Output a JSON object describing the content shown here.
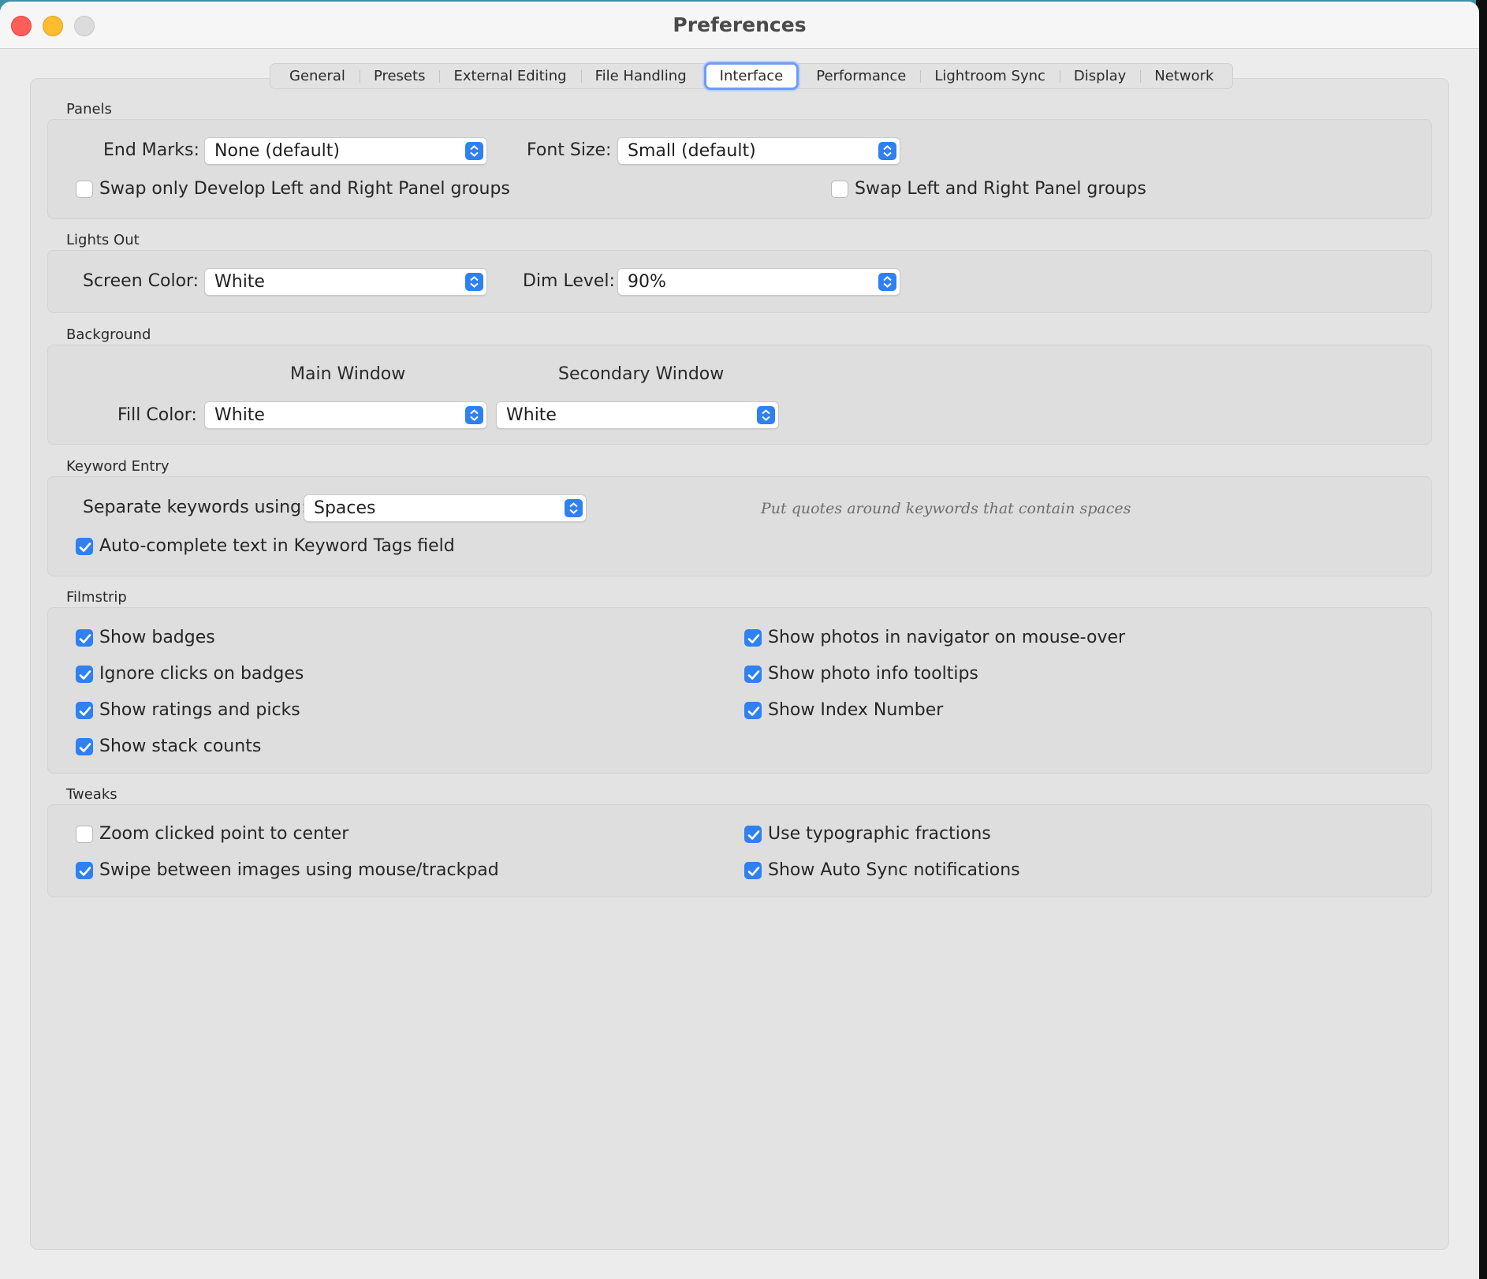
{
  "window": {
    "title": "Preferences"
  },
  "tabs": [
    {
      "label": "General",
      "selected": false
    },
    {
      "label": "Presets",
      "selected": false
    },
    {
      "label": "External Editing",
      "selected": false
    },
    {
      "label": "File Handling",
      "selected": false
    },
    {
      "label": "Interface",
      "selected": true
    },
    {
      "label": "Performance",
      "selected": false
    },
    {
      "label": "Lightroom Sync",
      "selected": false
    },
    {
      "label": "Display",
      "selected": false
    },
    {
      "label": "Network",
      "selected": false
    }
  ],
  "panels": {
    "title": "Panels",
    "end_marks": {
      "label": "End Marks:",
      "value": "None (default)"
    },
    "font_size": {
      "label": "Font Size:",
      "value": "Small (default)"
    },
    "swap_develop": {
      "label": "Swap only Develop Left and Right Panel groups",
      "checked": false
    },
    "swap_all": {
      "label": "Swap Left and Right Panel groups",
      "checked": false
    }
  },
  "lights_out": {
    "title": "Lights Out",
    "screen_color": {
      "label": "Screen Color:",
      "value": "White"
    },
    "dim_level": {
      "label": "Dim Level:",
      "value": "90%"
    }
  },
  "background": {
    "title": "Background",
    "main_window_header": "Main Window",
    "secondary_window_header": "Secondary Window",
    "fill_color_label": "Fill Color:",
    "main_value": "White",
    "secondary_value": "White"
  },
  "keyword_entry": {
    "title": "Keyword Entry",
    "separate": {
      "label": "Separate keywords using:",
      "value": "Spaces"
    },
    "hint": "Put quotes around keywords that contain spaces",
    "autocomplete": {
      "label": "Auto-complete text in Keyword Tags field",
      "checked": true
    }
  },
  "filmstrip": {
    "title": "Filmstrip",
    "show_badges": {
      "label": "Show badges",
      "checked": true
    },
    "ignore_clicks": {
      "label": "Ignore clicks on badges",
      "checked": true
    },
    "show_ratings": {
      "label": "Show ratings and picks",
      "checked": true
    },
    "show_stack": {
      "label": "Show stack counts",
      "checked": true
    },
    "show_navigator": {
      "label": "Show photos in navigator on mouse-over",
      "checked": true
    },
    "show_tooltips": {
      "label": "Show photo info tooltips",
      "checked": true
    },
    "show_index": {
      "label": "Show Index Number",
      "checked": true
    }
  },
  "tweaks": {
    "title": "Tweaks",
    "zoom_center": {
      "label": "Zoom clicked point to center",
      "checked": false
    },
    "swipe": {
      "label": "Swipe between images using mouse/trackpad",
      "checked": true
    },
    "typographic": {
      "label": "Use typographic fractions",
      "checked": true
    },
    "auto_sync": {
      "label": "Show Auto Sync notifications",
      "checked": true
    }
  },
  "colors": {
    "accent": "#2f80f0",
    "close": "#ff5f57",
    "minimize": "#febc2e"
  }
}
